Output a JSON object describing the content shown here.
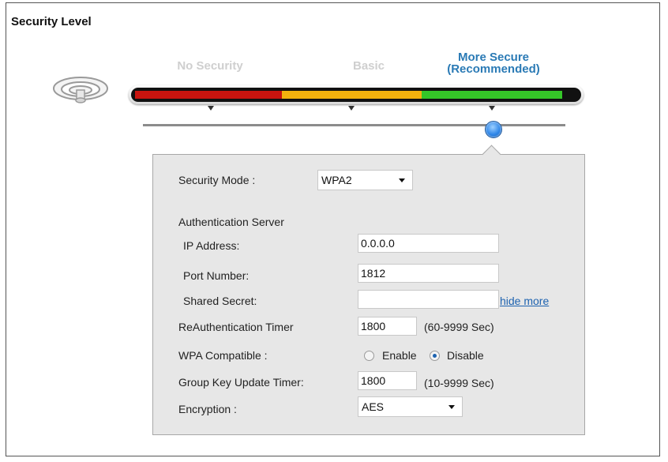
{
  "section_title": "Security Level",
  "levels": {
    "no_security": "No Security",
    "basic": "Basic",
    "more_secure_line1": "More Secure",
    "more_secure_line2": "(Recommended)",
    "selected": "More Secure"
  },
  "form": {
    "security_mode": {
      "label": "Security Mode :",
      "value": "WPA2"
    },
    "auth_server_heading": "Authentication Server",
    "ip_address": {
      "label": "IP Address:",
      "value": "0.0.0.0"
    },
    "port_number": {
      "label": "Port Number:",
      "value": "1812"
    },
    "shared_secret": {
      "label": "Shared Secret:",
      "value": ""
    },
    "hide_more_link": "hide more",
    "reauth_timer": {
      "label": "ReAuthentication Timer",
      "value": "1800",
      "hint": "(60-9999 Sec)"
    },
    "wpa_compatible": {
      "label": "WPA Compatible :",
      "enable_label": "Enable",
      "disable_label": "Disable",
      "selected": "Disable"
    },
    "group_key_timer": {
      "label": "Group Key Update Timer:",
      "value": "1800",
      "hint": "(10-9999 Sec)"
    },
    "encryption": {
      "label": "Encryption :",
      "value": "AES"
    }
  },
  "colors": {
    "no_security": "#c8140f",
    "basic": "#f3b20d",
    "more_secure": "#35c628",
    "accent": "#2a7ab5"
  },
  "icons": {
    "wireless": "wifi-icon"
  }
}
